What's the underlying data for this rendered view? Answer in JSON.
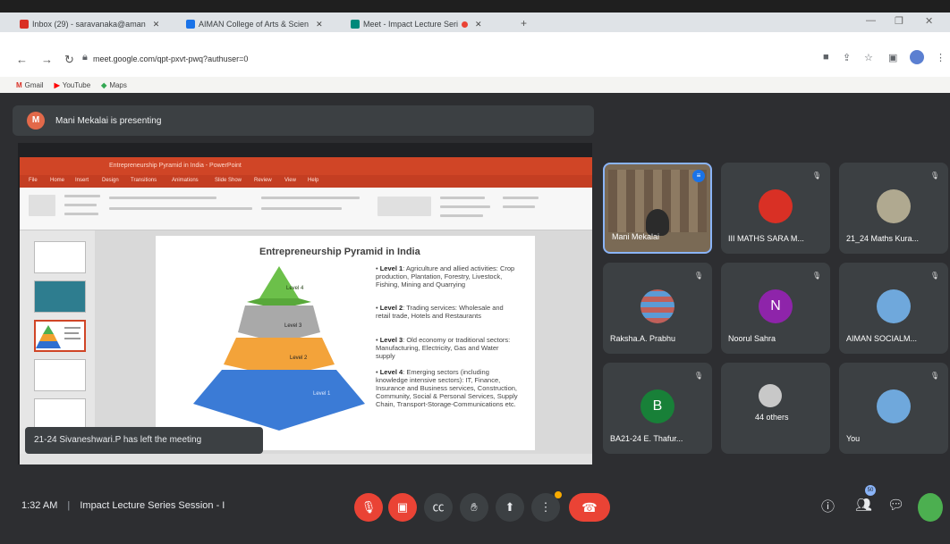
{
  "browser": {
    "tabs": [
      {
        "label": "Inbox (29) - saravanaka@aman",
        "color": "#d93025"
      },
      {
        "label": "AIMAN College of Arts & Scien",
        "color": "#1a73e8"
      },
      {
        "label": "Meet - Impact Lecture Seri",
        "color": "#1a73e8"
      }
    ],
    "url": "meet.google.com/qpt-pxvt-pwq?authuser=0",
    "bookmarks": [
      "Gmail",
      "YouTube",
      "Maps"
    ]
  },
  "meet": {
    "presenter_initial": "M",
    "presenting_text": "Mani Mekalai is presenting",
    "toast": "21-24 Sivaneshwari.P has left the meeting",
    "time": "1:32 AM",
    "meeting_title": "Impact Lecture Series Session - I",
    "participants_badge": "50",
    "participants": [
      {
        "name": "Mani Mekalai",
        "type": "video"
      },
      {
        "name": "III MATHS SARA M...",
        "color": "#d93025"
      },
      {
        "name": "21_24 Maths Kura...",
        "color": "#b0a990"
      },
      {
        "name": "Raksha.A. Prabhu",
        "color": "#c0605a"
      },
      {
        "name": "Noorul Sahra",
        "initial": "N",
        "color": "#8e24aa"
      },
      {
        "name": "AIMAN SOCIALM...",
        "color": "#6fa8dc"
      },
      {
        "name": "BA21-24 E. Thafur...",
        "initial": "B",
        "color": "#188038"
      },
      {
        "name": "44 others",
        "color": "#c8c8c8"
      },
      {
        "name": "You",
        "color": "#6fa8dc"
      }
    ]
  },
  "slide": {
    "window_title": "Entrepreneurship Pyramid in India - PowerPoint",
    "menu": [
      "File",
      "Home",
      "Insert",
      "Design",
      "Transitions",
      "Animations",
      "Slide Show",
      "Review",
      "View",
      "Help"
    ],
    "title": "Entrepreneurship Pyramid in India",
    "pyramid_levels": [
      "Level 4",
      "Level 3",
      "Level 2",
      "Level 1"
    ],
    "bullets": [
      {
        "head": "Level 1",
        "text": ": Agriculture and allied activities: Crop production, Plantation, Forestry, Livestock, Fishing, Mining and Quarrying"
      },
      {
        "head": "Level 2",
        "text": ": Trading services: Wholesale and retail trade, Hotels and Restaurants"
      },
      {
        "head": "Level 3",
        "text": ": Old economy or traditional sectors: Manufacturing, Electricity, Gas and Water supply"
      },
      {
        "head": "Level 4",
        "text": ": Emerging sectors (including knowledge intensive sectors): IT, Finance, Insurance and Business services, Construction, Community, Social & Personal Services, Supply Chain, Transport-Storage-Communications etc."
      }
    ]
  }
}
